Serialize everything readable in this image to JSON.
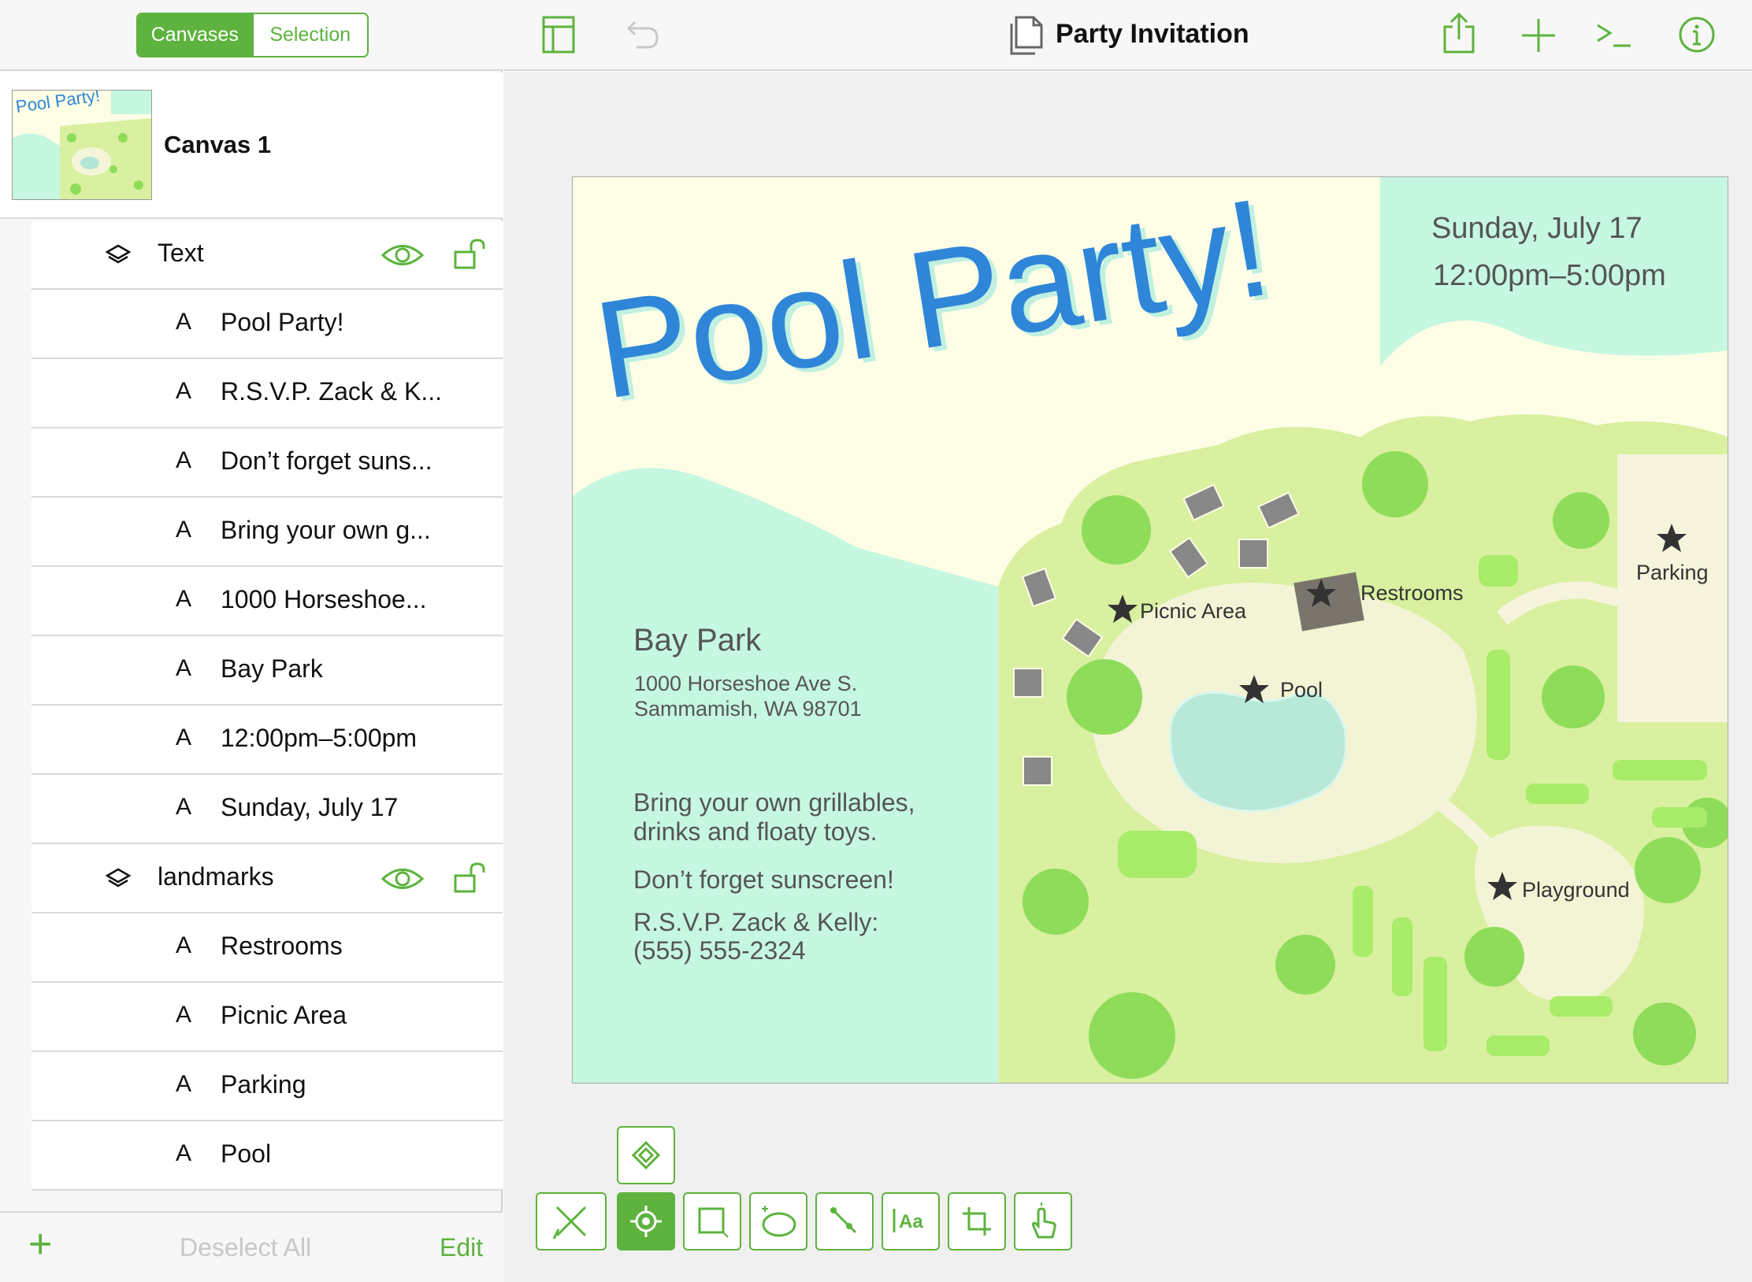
{
  "sidebar": {
    "segments": {
      "canvases": "Canvases",
      "selection": "Selection"
    },
    "canvas": {
      "name": "Canvas 1"
    },
    "thumbnail": {
      "title": "Pool Party!"
    },
    "layers": [
      {
        "name": "Text",
        "items": [
          "Pool Party!",
          "R.S.V.P. Zack & K...",
          "Don’t forget suns...",
          "Bring your own g...",
          "1000 Horseshoe...",
          "Bay Park",
          "12:00pm–5:00pm",
          "Sunday, July 17"
        ]
      },
      {
        "name": "landmarks",
        "items": [
          "Restrooms",
          "Picnic Area",
          "Parking",
          "Pool"
        ]
      }
    ],
    "item_icon": "A",
    "footer": {
      "add": "+",
      "deselect": "Deselect All",
      "edit": "Edit"
    }
  },
  "toolbar": {
    "title": "Party Invitation",
    "icons": [
      "sidebar-toggle-icon",
      "undo-icon",
      "document-icon",
      "share-icon",
      "add-icon",
      "console-icon",
      "info-icon"
    ]
  },
  "artboard": {
    "title": "Pool Party!",
    "date": "Sunday, July 17",
    "time": "12:00pm–5:00pm",
    "venue": "Bay Park",
    "address1": "1000 Horseshoe Ave S.",
    "address2": "Sammamish, WA 98701",
    "bring1": "Bring your own grillables,",
    "bring2": "drinks and floaty toys.",
    "sunscreen": "Don’t forget sunscreen!",
    "rsvp1": "R.S.V.P. Zack & Kelly:",
    "rsvp2": "(555) 555-2324",
    "landmarks": {
      "picnic": "Picnic Area",
      "restrooms": "Restrooms",
      "parking": "Parking",
      "pool": "Pool",
      "playground": "Playground"
    }
  },
  "colors": {
    "accent": "#5db33e",
    "title_blue": "#2f86d8",
    "mint": "#c6f7e0",
    "grass": "#d8f0a0",
    "tree": "#8fdc5a"
  },
  "tools": [
    "style-icon",
    "pen-icon",
    "selection-icon",
    "shape-icon",
    "diagram-icon",
    "line-icon",
    "text-icon",
    "crop-icon",
    "touch-icon"
  ]
}
